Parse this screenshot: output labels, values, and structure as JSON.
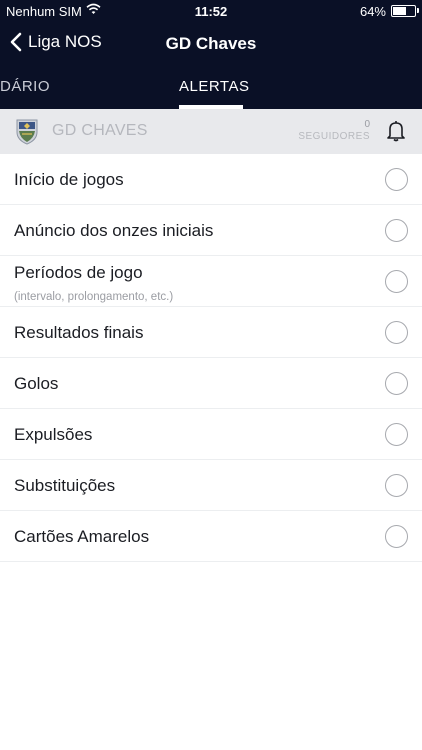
{
  "status_bar": {
    "carrier": "Nenhum SIM",
    "time": "11:52",
    "battery_percent": "64%",
    "battery_level": 0.64
  },
  "nav": {
    "back_label": "Liga NOS",
    "title": "GD Chaves"
  },
  "tabs": {
    "previous_partial": "DÁRIO",
    "active": "ALERTAS"
  },
  "team": {
    "name": "GD CHAVES",
    "followers_count": "0",
    "followers_label": "SEGUIDORES"
  },
  "alerts": [
    {
      "label": "Início de jogos",
      "checked": false
    },
    {
      "label": "Anúncio dos onzes iniciais",
      "checked": false
    },
    {
      "label": "Períodos de jogo",
      "sublabel": "(intervalo, prolongamento, etc.)",
      "checked": false
    },
    {
      "label": "Resultados finais",
      "checked": false
    },
    {
      "label": "Golos",
      "checked": false
    },
    {
      "label": "Expulsões",
      "checked": false
    },
    {
      "label": "Substituições",
      "checked": false
    },
    {
      "label": "Cartões Amarelos",
      "checked": false
    }
  ],
  "colors": {
    "header_bg": "#0a1026",
    "team_bar_bg": "#e8e9ec",
    "accent": "#ffffff"
  },
  "icons": {
    "back": "chevron-left-icon",
    "wifi": "wifi-icon",
    "battery": "battery-icon",
    "crest": "team-crest-icon",
    "bell": "bell-icon",
    "radio": "radio-circle-icon"
  }
}
